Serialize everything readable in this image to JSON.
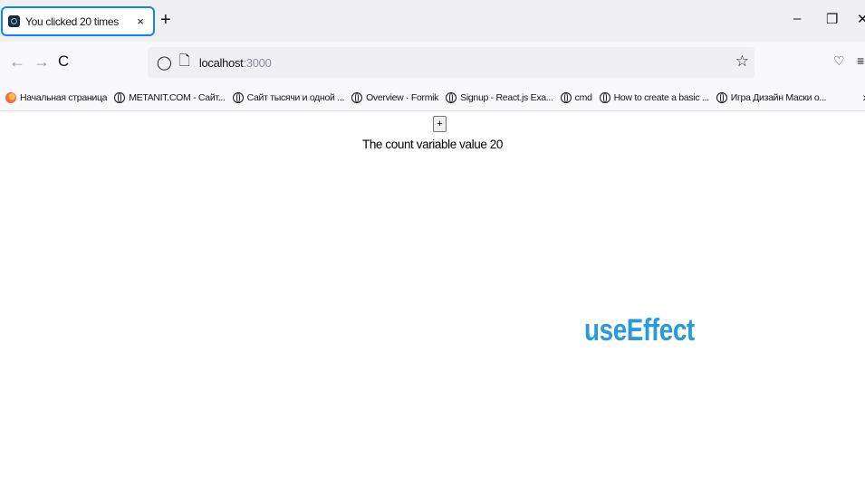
{
  "tab": {
    "title": "You clicked 20 times",
    "close": "×",
    "favicon": "react-icon"
  },
  "new_tab": "+",
  "window_controls": {
    "minimize": "–",
    "restore": "❐",
    "close": "✕"
  },
  "nav": {
    "back": "←",
    "forward": "→",
    "reload": "C"
  },
  "url": {
    "host": "localhost",
    "port": ":3000",
    "shield": "◯",
    "page_icon": "🗋",
    "star": "☆"
  },
  "toolbar": {
    "pocket": "♡",
    "menu": "≡"
  },
  "bookmarks": [
    {
      "label": "Начальная страница",
      "icon": "firefox-icon"
    },
    {
      "label": "METANIT.COM - Сайт...",
      "icon": "globe-icon"
    },
    {
      "label": "Сайт тысячи и одной ...",
      "icon": "globe-icon"
    },
    {
      "label": "Overview · Formik",
      "icon": "globe-icon"
    },
    {
      "label": "Signup - React.js Exa...",
      "icon": "globe-icon"
    },
    {
      "label": "cmd",
      "icon": "globe-icon"
    },
    {
      "label": "How to create a basic ...",
      "icon": "globe-icon"
    },
    {
      "label": "Игра Дизайн Маски о...",
      "icon": "globe-icon"
    }
  ],
  "bookmarks_more": "›",
  "page": {
    "plus_label": "+",
    "count_text": "The count variable value 20",
    "hook_title": "useEffect"
  },
  "colors": {
    "accent": "#0a84ff",
    "hook_title": "#2a9bd8"
  }
}
